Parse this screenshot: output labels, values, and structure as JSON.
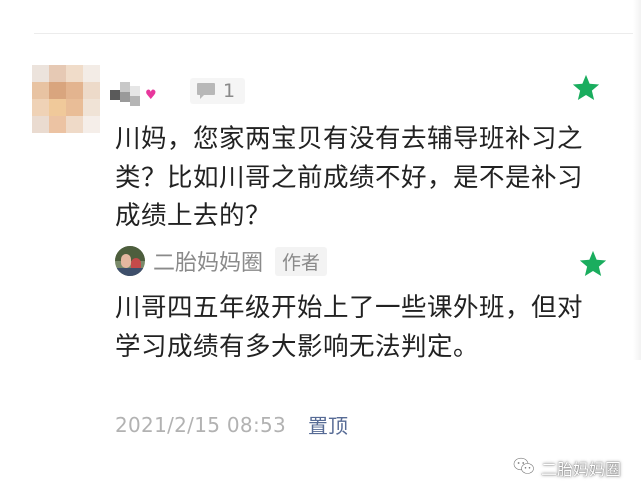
{
  "comment": {
    "reply_count": "1",
    "text": "川妈，您家两宝贝有没有去辅导班补习之类？比如川哥之前成绩不好，是不是补习成绩上去的？",
    "star_color": "#1aad5e"
  },
  "reply": {
    "author_name": "二胎妈妈圈",
    "author_badge": "作者",
    "text": "川哥四五年级开始上了一些课外班，但对学习成绩有多大影响无法判定。",
    "timestamp": "2021/2/15 08:53",
    "pin_label": "置顶",
    "link_color": "#576b95"
  },
  "watermark": {
    "label": "二胎妈妈圈",
    "icon": "wechat-icon"
  }
}
